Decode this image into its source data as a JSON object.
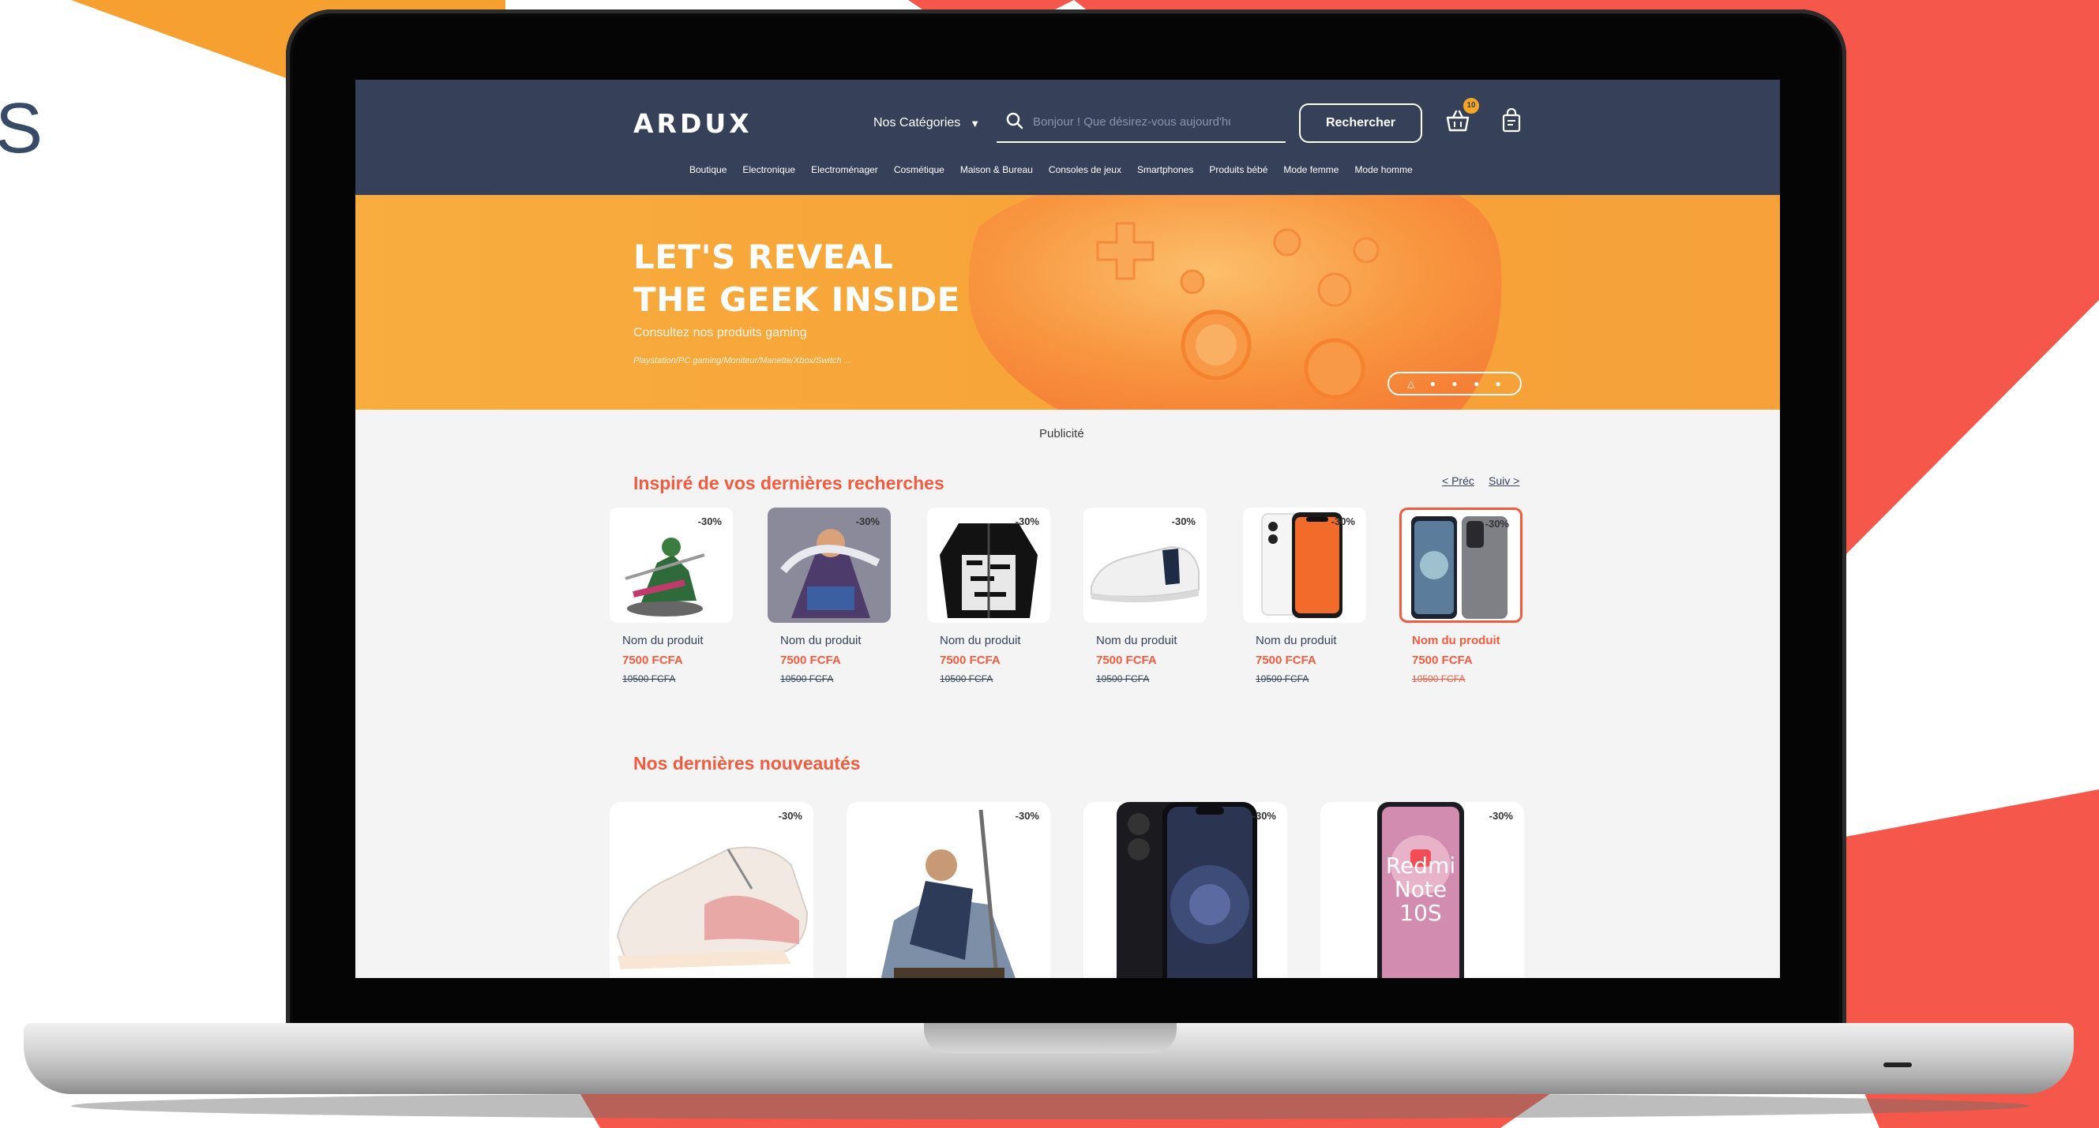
{
  "side_text": "S",
  "header": {
    "logo": "ARDUX",
    "categories_label": "Nos Catégories",
    "search_placeholder": "Bonjour ! Que désirez-vous aujourd'hui ?",
    "search_button": "Rechercher",
    "cart_count": "10"
  },
  "nav": [
    "Boutique",
    "Electronique",
    "Electroménager",
    "Cosmétique",
    "Maison & Bureau",
    "Consoles de jeux",
    "Smartphones",
    "Produits bébé",
    "Mode femme",
    "Mode homme"
  ],
  "banner": {
    "title_line1": "LET'S REVEAL",
    "title_line2": "THE GEEK INSIDE",
    "subtitle": "Consultez nos produits gaming",
    "details": "Playstation/PC gaming/Moniteur/Manette/Xbox/Switch ..."
  },
  "ad_label": "Publicité",
  "section1": {
    "title": "Inspiré de vos dernières recherches",
    "prev": "< Préc",
    "next": "Suiv >",
    "products": [
      {
        "name": "Nom du produit",
        "price": "7500 FCFA",
        "old_price": "10500 FCFA",
        "discount": "-30%"
      },
      {
        "name": "Nom du produit",
        "price": "7500 FCFA",
        "old_price": "10500 FCFA",
        "discount": "-30%"
      },
      {
        "name": "Nom du produit",
        "price": "7500 FCFA",
        "old_price": "10500 FCFA",
        "discount": "-30%"
      },
      {
        "name": "Nom du produit",
        "price": "7500 FCFA",
        "old_price": "10500 FCFA",
        "discount": "-30%"
      },
      {
        "name": "Nom du produit",
        "price": "7500 FCFA",
        "old_price": "10500 FCFA",
        "discount": "-30%"
      },
      {
        "name": "Nom du produit",
        "price": "7500 FCFA",
        "old_price": "10500 FCFA",
        "discount": "-30%"
      }
    ]
  },
  "section2": {
    "title": "Nos dernières nouveautés",
    "products": [
      {
        "discount": "-30%"
      },
      {
        "discount": "-30%"
      },
      {
        "discount": "-30%"
      },
      {
        "discount": "-30%",
        "phone_text_1": "Redmi",
        "phone_text_2": "Note",
        "phone_text_3": "10S"
      }
    ]
  },
  "colors": {
    "header": "#364159",
    "accent": "#f35b3e",
    "banner": "#f7a438"
  }
}
